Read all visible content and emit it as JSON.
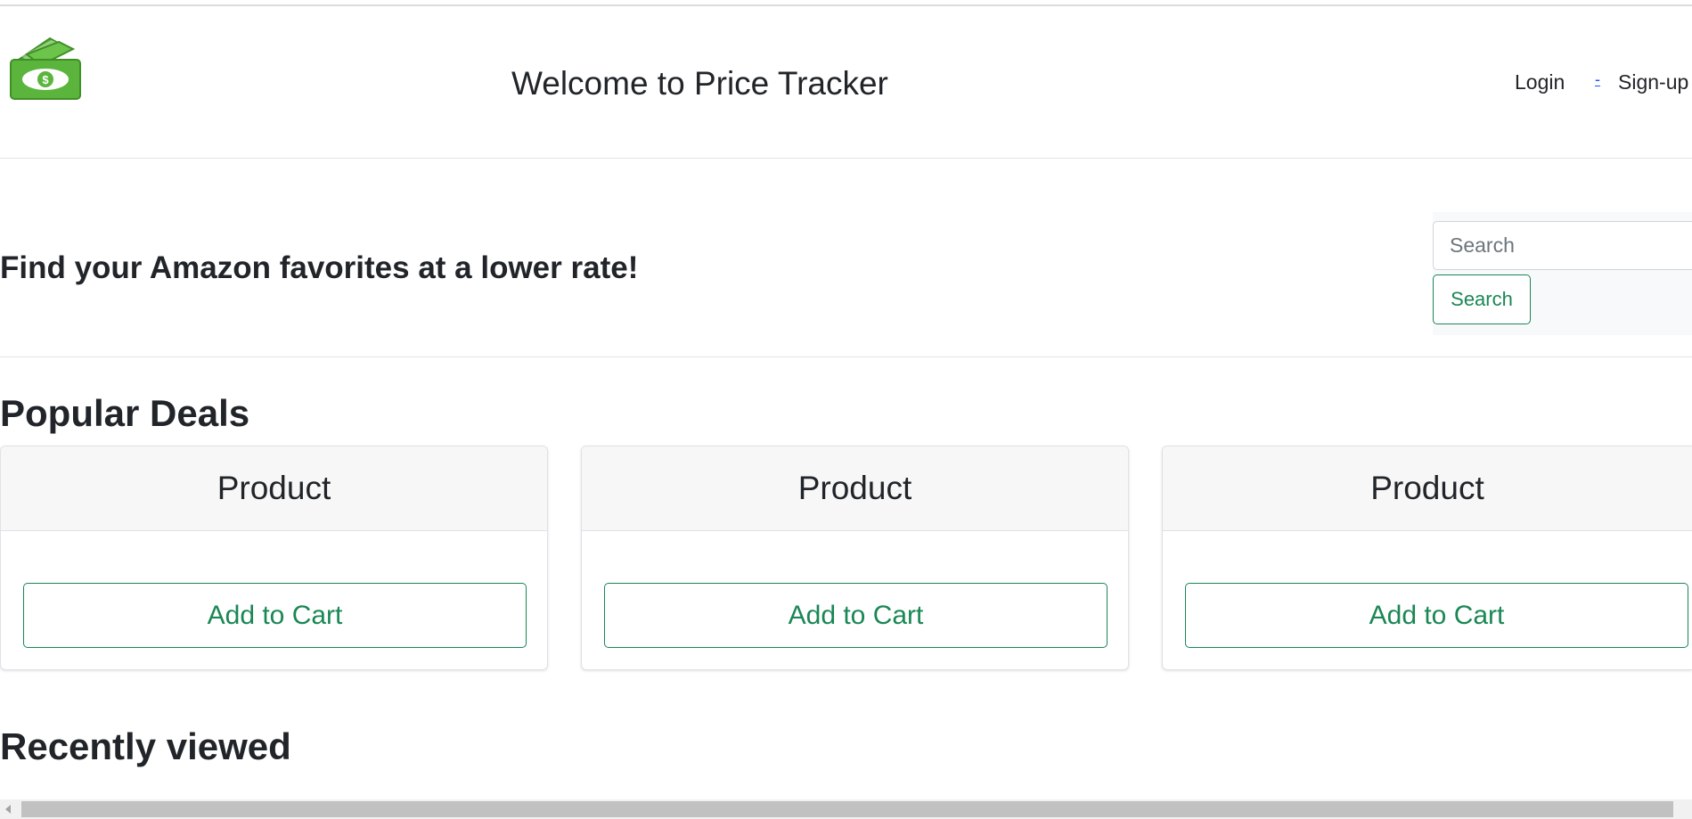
{
  "header": {
    "site_title": "Welcome to Price Tracker",
    "nav": {
      "login": "Login",
      "separator": "-",
      "signup": "Sign-up"
    },
    "logo_icon": "money-stack-icon",
    "logo_symbol": "$"
  },
  "hero": {
    "tagline": "Find your Amazon favorites at a lower rate!",
    "search": {
      "placeholder": "Search",
      "value": "",
      "button_label": "Search"
    }
  },
  "popular_deals": {
    "title": "Popular Deals",
    "cards": [
      {
        "title": "Product",
        "button_label": "Add to Cart"
      },
      {
        "title": "Product",
        "button_label": "Add to Cart"
      },
      {
        "title": "Product",
        "button_label": "Add to Cart"
      }
    ]
  },
  "recently_viewed": {
    "title": "Recently viewed"
  },
  "colors": {
    "accent": "#198754",
    "logo_green": "#5bb53c",
    "text": "#212529"
  }
}
